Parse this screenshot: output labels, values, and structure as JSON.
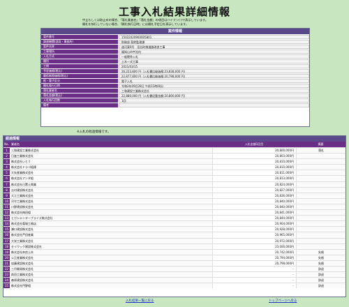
{
  "page": {
    "title": "工事入札結果詳細情報",
    "notes": [
      "中止もしくは取止めの場合、「落札業者名」「落札金額」の項目はハイフン(-)で表示しています。",
      "開札を執行していない場合、「開札執行日時」には開札予定日を表示しています。"
    ],
    "history_note": "※入札の経過情報です。"
  },
  "case_info": {
    "header": "案件情報",
    "rows": [
      {
        "label": "案件番号",
        "value": "15022020900005801"
      },
      {
        "label": "調達機関(部局・事務所)",
        "value": "財務部 契約監理課"
      },
      {
        "label": "案件名称",
        "value": "道河東9号　田谷町線道路改良工事"
      },
      {
        "label": "工事場所",
        "value": "福知山市宇治内"
      },
      {
        "label": "入札方式",
        "value": "一般競争入札"
      },
      {
        "label": "種別",
        "value": "土木一式工事"
      },
      {
        "label": "工期",
        "value": "2021/03/15"
      },
      {
        "label": "予定価格(税込)",
        "value": "26,223,800 円（入札書比較価格:23,838,000 円）"
      },
      {
        "label": "最低制限価格(税込)",
        "value": "22,877,800 円（入札書比較価格:20,798,000 円）"
      },
      {
        "label": "紙・電子区分",
        "value": "電子入札"
      },
      {
        "label": "開札執行日時",
        "value": "令和2年09月28日 午前11時00分"
      },
      {
        "label": "落札業者名",
        "value": "三和建設工業株式会社"
      },
      {
        "label": "落札金額(税込)",
        "value": "22,880,000 円（入札書記載金額:20,800,000 円）"
      },
      {
        "label": "入札執行回数",
        "value": "1回"
      },
      {
        "label": "備考",
        "value": ""
      }
    ]
  },
  "history": {
    "header": "経過情報",
    "columns": {
      "no": "No.",
      "name": "業者名",
      "price": "入札金額1回目",
      "note": "摘要"
    },
    "rows": [
      {
        "no": "1",
        "name": "三和建設工業株式会社",
        "price": "20,800,000円",
        "note": "落札"
      },
      {
        "no": "2",
        "name": "日進工業株式会社",
        "price": "20,803,000円",
        "note": ""
      },
      {
        "no": "3",
        "name": "株式会社いとう",
        "price": "20,810,000円",
        "note": ""
      },
      {
        "no": "4",
        "name": "株式会社ドラゴ組建",
        "price": "20,810,000円",
        "note": ""
      },
      {
        "no": "5",
        "name": "大矢産業株式会社",
        "price": "20,811,000円",
        "note": ""
      },
      {
        "no": "6",
        "name": "株式会社アンダ組",
        "price": "20,813,000円",
        "note": ""
      },
      {
        "no": "7",
        "name": "株式会社日置土興業",
        "price": "20,824,000円",
        "note": ""
      },
      {
        "no": "8",
        "name": "吉村建設株式会社",
        "price": "20,827,000円",
        "note": ""
      },
      {
        "no": "9",
        "name": "大江工業株式会社",
        "price": "20,836,000円",
        "note": ""
      },
      {
        "no": "10",
        "name": "河守工業株式会社",
        "price": "20,840,000円",
        "note": ""
      },
      {
        "no": "11",
        "name": "川野建設株式会社",
        "price": "20,840,000円",
        "note": ""
      },
      {
        "no": "12",
        "name": "株式会社梅田組",
        "price": "20,841,000円",
        "note": ""
      },
      {
        "no": "13",
        "name": "ヒガシエンタープライズ株式会社",
        "price": "20,844,000円",
        "note": ""
      },
      {
        "no": "14",
        "name": "株式会社竜城工務店",
        "price": "20,904,000円",
        "note": ""
      },
      {
        "no": "15",
        "name": "瀬口建設株式会社",
        "price": "20,928,000円",
        "note": ""
      },
      {
        "no": "16",
        "name": "株式会社芦田産業",
        "price": "20,965,000円",
        "note": ""
      },
      {
        "no": "17",
        "name": "大栄工業株式会社",
        "price": "20,972,000円",
        "note": ""
      },
      {
        "no": "18",
        "name": "セイワック建設株式会社",
        "price": "23,000,000円",
        "note": ""
      },
      {
        "no": "19",
        "name": "株式会社奈良土木",
        "price": "20,742,000円",
        "note": "失格"
      },
      {
        "no": "20",
        "name": "公正産業株式会社",
        "price": "20,794,000円",
        "note": "失格"
      },
      {
        "no": "21",
        "name": "加藤建設株式会社",
        "price": "20,798,000円",
        "note": "失格"
      },
      {
        "no": "22",
        "name": "三丹開発株式会社",
        "price": "-",
        "note": "辞退"
      },
      {
        "no": "23",
        "name": "前田工業株式会社",
        "price": "-",
        "note": "辞退"
      },
      {
        "no": "24",
        "name": "森原建設株式会社",
        "price": "-",
        "note": "辞退"
      },
      {
        "no": "25",
        "name": "株式会社門野組",
        "price": "-",
        "note": "辞退"
      }
    ]
  },
  "footer": {
    "link_list": "入札結果一覧に戻る",
    "link_top": "トップページへ戻る"
  }
}
